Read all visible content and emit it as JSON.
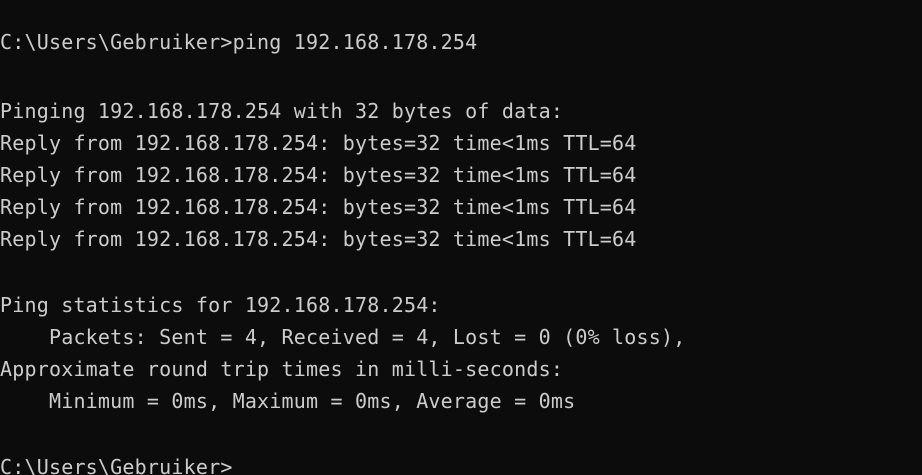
{
  "terminal": {
    "lines": [
      "C:\\Users\\Gebruiker>ping 192.168.178.254",
      "",
      "Pinging 192.168.178.254 with 32 bytes of data:",
      "Reply from 192.168.178.254: bytes=32 time<1ms TTL=64",
      "Reply from 192.168.178.254: bytes=32 time<1ms TTL=64",
      "Reply from 192.168.178.254: bytes=32 time<1ms TTL=64",
      "Reply from 192.168.178.254: bytes=32 time<1ms TTL=64",
      "",
      "Ping statistics for 192.168.178.254:",
      "    Packets: Sent = 4, Received = 4, Lost = 0 (0% loss),",
      "Approximate round trip times in milli-seconds:",
      "    Minimum = 0ms, Maximum = 0ms, Average = 0ms",
      "",
      "C:\\Users\\Gebruiker>"
    ],
    "colors": {
      "background": "#0c0c0c",
      "foreground": "#cccccc"
    }
  }
}
